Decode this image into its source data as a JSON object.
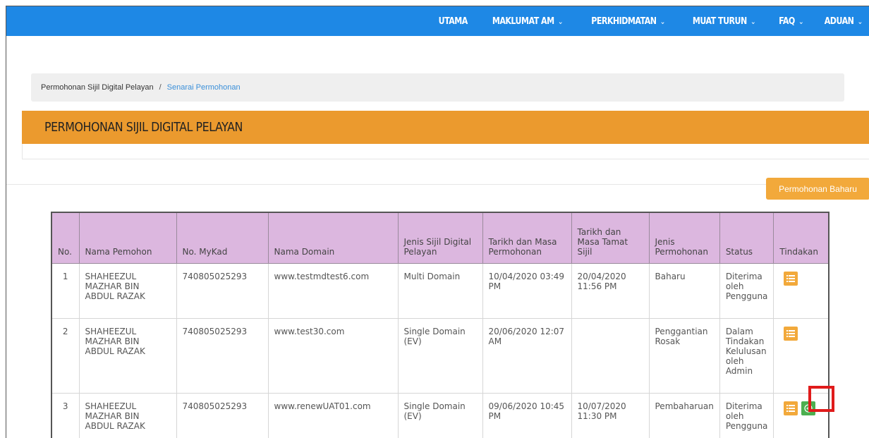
{
  "nav": {
    "items": [
      {
        "label": "UTAMA",
        "dropdown": false
      },
      {
        "label": "MAKLUMAT AM",
        "dropdown": true
      },
      {
        "label": "PERKHIDMATAN",
        "dropdown": true
      },
      {
        "label": "MUAT TURUN",
        "dropdown": true
      },
      {
        "label": "FAQ",
        "dropdown": true
      },
      {
        "label": "ADUAN",
        "dropdown": true
      }
    ],
    "chevron": "⌄"
  },
  "breadcrumb": {
    "parent": "Permohonan Sijil Digital Pelayan",
    "separator": "/",
    "current": "Senarai Permohonan"
  },
  "page_title": "PERMOHONAN SIJIL DIGITAL PELAYAN",
  "new_button_label": "Permohonan Baharu",
  "table": {
    "headers": [
      "No.",
      "Nama Pemohon",
      "No. MyKad",
      "Nama Domain",
      "Jenis Sijil Digital Pelayan",
      "Tarikh dan Masa Permohonan",
      "Tarikh dan Masa Tamat Sijil",
      "Jenis Permohonan",
      "Status",
      "Tindakan"
    ],
    "rows": [
      {
        "no": "1",
        "nama": "SHAHEEZUL MAZHAR BIN ABDUL RAZAK",
        "mykad": "740805025293",
        "domain": "www.testmdtest6.com",
        "jenis": "Multi Domain",
        "tarikh_mohon": "10/04/2020 03:49 PM",
        "tarikh_tamat": "20/04/2020 11:56 PM",
        "jenis_mohon": "Baharu",
        "status": "Diterima oleh Pengguna"
      },
      {
        "no": "2",
        "nama": "SHAHEEZUL MAZHAR BIN ABDUL RAZAK",
        "mykad": "740805025293",
        "domain": "www.test30.com",
        "jenis": "Single Domain (EV)",
        "tarikh_mohon": "20/06/2020 12:07 AM",
        "tarikh_tamat": "",
        "jenis_mohon": "Penggantian Rosak",
        "status": "Dalam Tindakan Kelulusan oleh Admin"
      },
      {
        "no": "3",
        "nama": "SHAHEEZUL MAZHAR BIN ABDUL RAZAK",
        "mykad": "740805025293",
        "domain": "www.renewUAT01.com",
        "jenis": "Single Domain (EV)",
        "tarikh_mohon": "09/06/2020 10:45 PM",
        "tarikh_tamat": "10/07/2020 11:30 PM",
        "jenis_mohon": "Pembaharuan",
        "status": "Diterima oleh Pengguna"
      }
    ]
  },
  "colors": {
    "nav_bg": "#1e88e5",
    "header_bg": "#eb9a2e",
    "table_header_bg": "#dcb7df",
    "action_orange": "#f2a93b",
    "action_green": "#4caf50",
    "highlight": "#e01b1b"
  }
}
